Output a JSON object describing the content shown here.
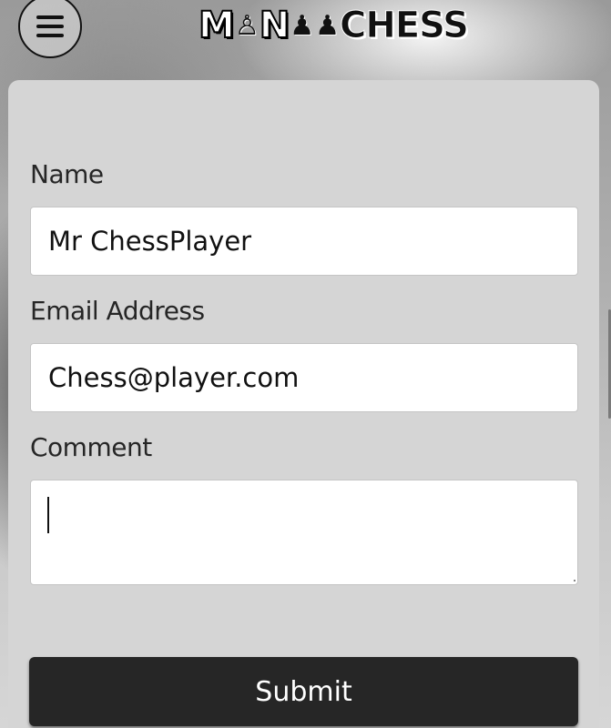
{
  "header": {
    "menu_icon": "hamburger-menu-icon",
    "logo": {
      "part1": "M",
      "part2": "N",
      "part3": "CHESS",
      "piece1": "♙",
      "piece2": "♟",
      "piece3": "♟"
    }
  },
  "form": {
    "name_label": "Name",
    "name_value": "Mr ChessPlayer",
    "email_label": "Email Address",
    "email_value": "Chess@player.com",
    "comment_label": "Comment",
    "comment_value": "",
    "submit_label": "Submit"
  },
  "colors": {
    "card_background": "#d5d5d5",
    "submit_background": "#262626",
    "submit_text": "#ffffff"
  }
}
